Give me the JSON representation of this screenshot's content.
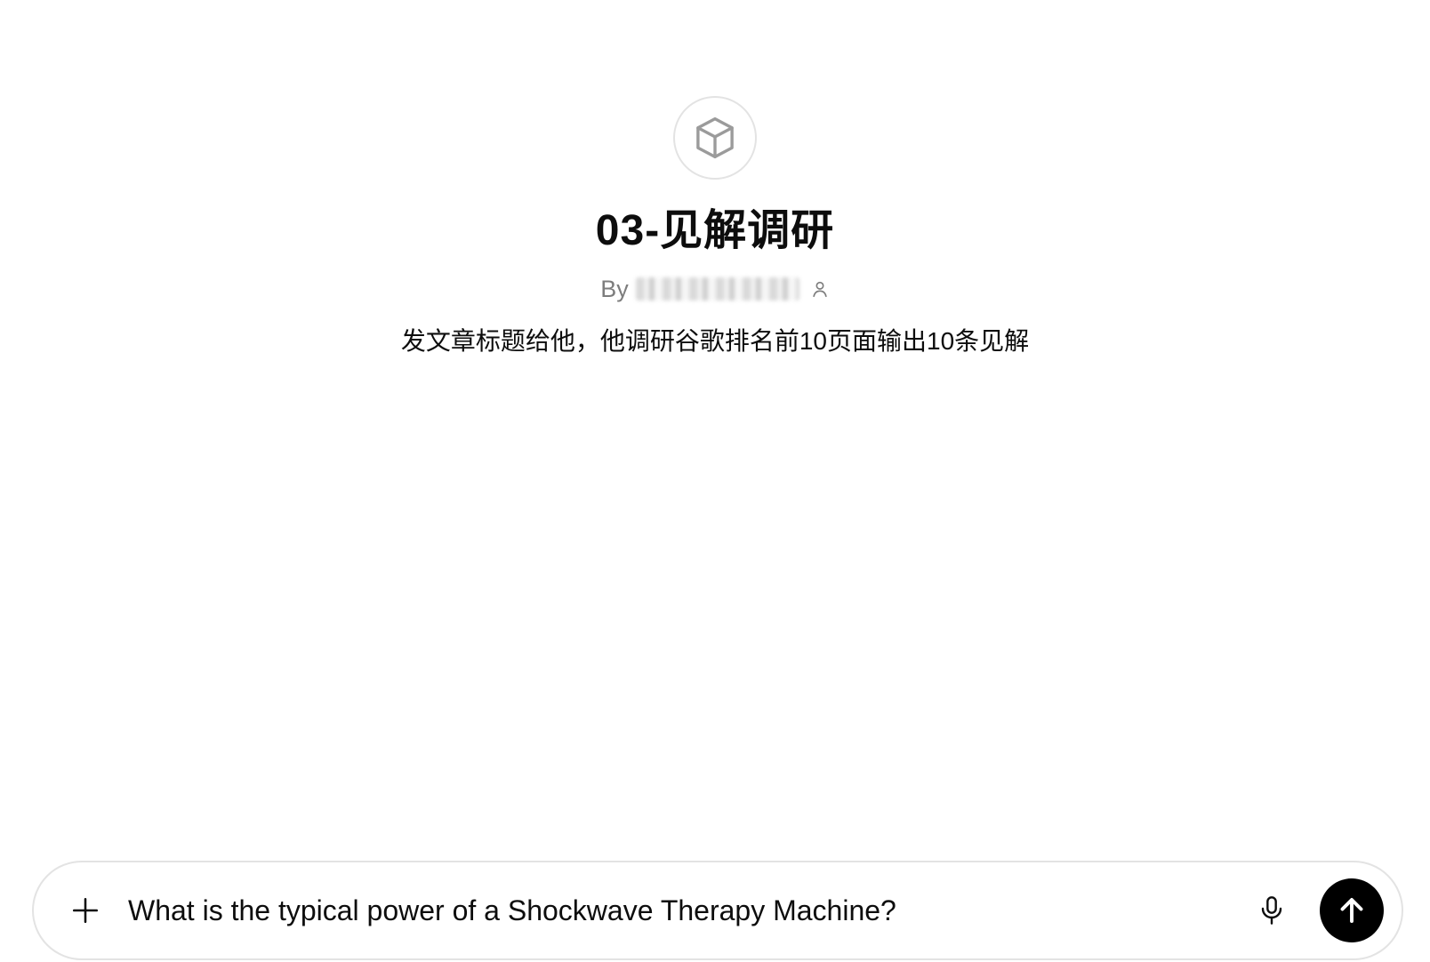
{
  "gpt": {
    "avatar_icon": "cube-icon",
    "title": "03-见解调研",
    "byline_prefix": "By",
    "author_icon": "person-icon",
    "description": "发文章标题给他，他调研谷歌排名前10页面输出10条见解"
  },
  "composer": {
    "attach_icon": "plus-icon",
    "prompt": "What is the typical power of a Shockwave Therapy Machine?",
    "mic_icon": "microphone-icon",
    "send_icon": "arrow-up-icon"
  },
  "colors": {
    "background": "#ffffff",
    "text": "#0d0d0d",
    "muted": "#7d7d7d",
    "border": "#e3e3e3",
    "send_button": "#000000"
  }
}
